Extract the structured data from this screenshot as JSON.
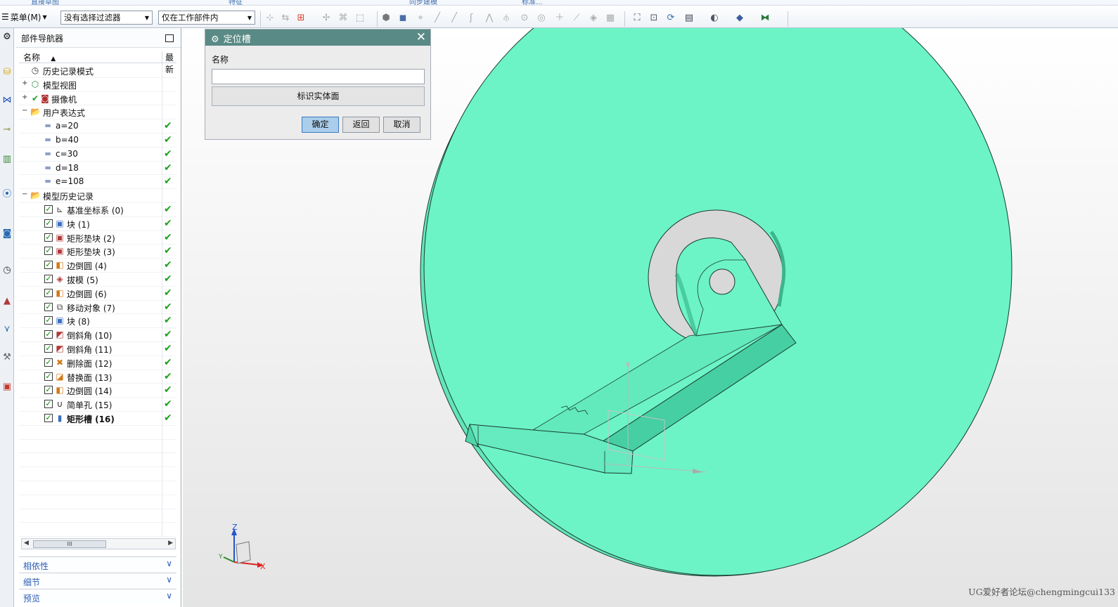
{
  "top_ribbon": {
    "tabs": [
      "直接草图",
      "特征",
      "同步建模",
      "标准..."
    ]
  },
  "toolbar": {
    "menu_label": "菜单(M)",
    "filter_value": "没有选择过滤器",
    "scope_value": "仅在工作部件内"
  },
  "navigator": {
    "title": "部件导航器",
    "col_name": "名称",
    "col_latest": "最新",
    "rows": [
      {
        "label": "历史记录模式",
        "icon": "clock-icon",
        "level": 0
      },
      {
        "label": "模型视图",
        "icon": "model-view-icon",
        "level": 0
      },
      {
        "label": "摄像机",
        "icon": "camera-icon",
        "level": 0
      },
      {
        "label": "用户表达式",
        "icon": "folder-icon",
        "level": 0
      },
      {
        "label": "a=20",
        "icon": "expression-icon",
        "level": 1,
        "status": "✔"
      },
      {
        "label": "b=40",
        "icon": "expression-icon",
        "level": 1,
        "status": "✔"
      },
      {
        "label": "c=30",
        "icon": "expression-icon",
        "level": 1,
        "status": "✔"
      },
      {
        "label": "d=18",
        "icon": "expression-icon",
        "level": 1,
        "status": "✔"
      },
      {
        "label": "e=108",
        "icon": "expression-icon",
        "level": 1,
        "status": "✔"
      },
      {
        "label": "模型历史记录",
        "icon": "folder-icon",
        "level": 0
      },
      {
        "label": "基准坐标系 (0)",
        "icon": "datum-csys-icon",
        "level": 1,
        "status": "✔"
      },
      {
        "label": "块 (1)",
        "icon": "block-icon",
        "level": 1,
        "status": "✔"
      },
      {
        "label": "矩形垫块 (2)",
        "icon": "pad-icon",
        "level": 1,
        "status": "✔"
      },
      {
        "label": "矩形垫块 (3)",
        "icon": "pad-icon",
        "level": 1,
        "status": "✔"
      },
      {
        "label": "边倒圆 (4)",
        "icon": "blend-icon",
        "level": 1,
        "status": "✔"
      },
      {
        "label": "拔模 (5)",
        "icon": "draft-icon",
        "level": 1,
        "status": "✔"
      },
      {
        "label": "边倒圆 (6)",
        "icon": "blend-icon",
        "level": 1,
        "status": "✔"
      },
      {
        "label": "移动对象 (7)",
        "icon": "move-object-icon",
        "level": 1,
        "status": "✔"
      },
      {
        "label": "块 (8)",
        "icon": "block-icon",
        "level": 1,
        "status": "✔"
      },
      {
        "label": "倒斜角 (10)",
        "icon": "chamfer-icon",
        "level": 1,
        "status": "✔"
      },
      {
        "label": "倒斜角 (11)",
        "icon": "chamfer-icon",
        "level": 1,
        "status": "✔"
      },
      {
        "label": "删除面 (12)",
        "icon": "delete-face-icon",
        "level": 1,
        "status": "✔"
      },
      {
        "label": "替换面 (13)",
        "icon": "replace-face-icon",
        "level": 1,
        "status": "✔"
      },
      {
        "label": "边倒圆 (14)",
        "icon": "blend-icon",
        "level": 1,
        "status": "✔"
      },
      {
        "label": "简单孔 (15)",
        "icon": "hole-icon",
        "level": 1,
        "status": "✔"
      },
      {
        "label": "矩形槽 (16)",
        "icon": "slot-icon",
        "level": 1,
        "status": "✔",
        "bold": true
      }
    ],
    "scroll_thumb": "III",
    "panels": [
      "相依性",
      "细节",
      "预览"
    ]
  },
  "dialog": {
    "title": "定位槽",
    "name_label": "名称",
    "name_value": "",
    "face_button": "标识实体面",
    "ok": "确定",
    "back": "返回",
    "cancel": "取消"
  },
  "triad": {
    "z": "Z",
    "x": "X",
    "y": "Y"
  },
  "watermark": "UG爱好者论坛@chengmingcui133",
  "colors": {
    "solid": "#6cf4c7",
    "dialog_title": "#5a8a85",
    "ok_button": "#a9cdea",
    "check": "#1ea01e"
  }
}
